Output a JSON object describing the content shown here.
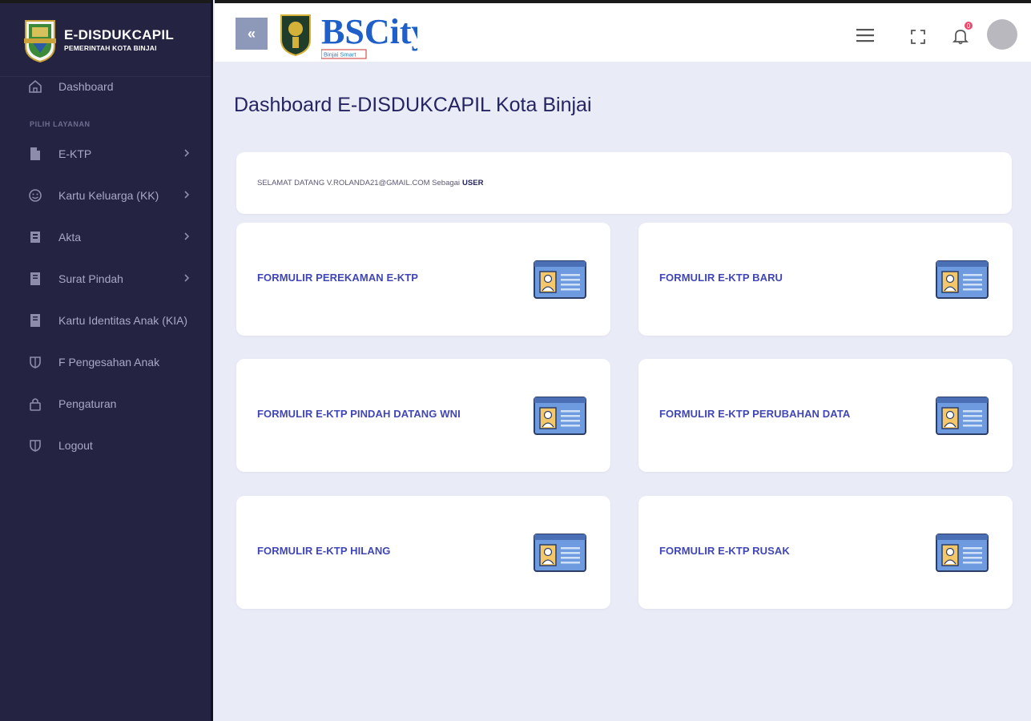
{
  "brand": {
    "title": "E-DISDUKCAPIL",
    "subtitle": "PEMERINTAH KOTA BINJAI",
    "logo_icon": "city-crest-icon"
  },
  "sidebar": {
    "dashboard": {
      "label": "Dashboard",
      "icon": "home-icon"
    },
    "section_label": "PILIH LAYANAN",
    "items": [
      {
        "label": "E-KTP",
        "icon": "document-icon",
        "has_submenu": true
      },
      {
        "label": "Kartu Keluarga (KK)",
        "icon": "smile-icon",
        "has_submenu": true
      },
      {
        "label": "Akta",
        "icon": "book-icon",
        "has_submenu": true
      },
      {
        "label": "Surat Pindah",
        "icon": "file-icon",
        "has_submenu": true
      },
      {
        "label": "Kartu Identitas Anak (KIA)",
        "icon": "file-icon",
        "has_submenu": false
      },
      {
        "label": "F Pengesahan Anak",
        "icon": "shield-icon",
        "has_submenu": false
      },
      {
        "label": "Pengaturan",
        "icon": "lock-icon",
        "has_submenu": false
      },
      {
        "label": "Logout",
        "icon": "shield-icon",
        "has_submenu": false
      }
    ]
  },
  "topbar": {
    "collapse_label": "«",
    "bscity_text": "BSCity",
    "bscity_sub": "Binjai Smart",
    "notification_count": "0"
  },
  "main": {
    "title": "Dashboard E-DISDUKCAPIL Kota Binjai",
    "welcome_text": "SELAMAT DATANG V.ROLANDA21@GMAIL.COM Sebagai",
    "welcome_role": "USER",
    "forms": [
      {
        "label": "FORMULIR PEREKAMAN E-KTP",
        "icon": "id-card-icon"
      },
      {
        "label": "FORMULIR E-KTP BARU",
        "icon": "id-card-icon"
      },
      {
        "label": "FORMULIR E-KTP PINDAH DATANG WNI",
        "icon": "id-card-icon"
      },
      {
        "label": "FORMULIR E-KTP PERUBAHAN DATA",
        "icon": "id-card-icon"
      },
      {
        "label": "FORMULIR E-KTP HILANG",
        "icon": "id-card-icon"
      },
      {
        "label": "FORMULIR E-KTP RUSAK",
        "icon": "id-card-icon"
      }
    ]
  },
  "colors": {
    "sidebar_bg": "#242341",
    "accent": "#4046b5",
    "page_bg": "#e9ebf6",
    "badge": "#f2456a"
  }
}
